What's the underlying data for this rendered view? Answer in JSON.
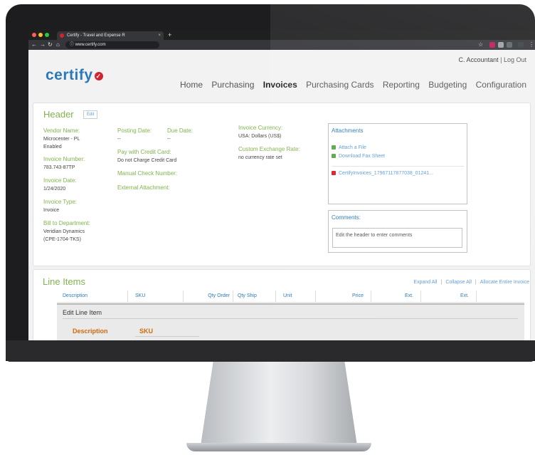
{
  "browser": {
    "tab_title": "Certify - Travel and Expense R",
    "tab_close": "×",
    "new_tab": "+",
    "url": "www.certify.com",
    "nav_icons": [
      "back-icon",
      "forward-icon",
      "reload-icon",
      "home-icon",
      "info-icon"
    ]
  },
  "app": {
    "logo_text": "certify",
    "user_name": "C. Accountant",
    "user_sep": "|",
    "logout": "Log Out",
    "nav": [
      "Home",
      "Purchasing",
      "Invoices",
      "Purchasing Cards",
      "Reporting",
      "Budgeting",
      "Configuration"
    ],
    "active_nav": "Invoices"
  },
  "header": {
    "title": "Header",
    "edit": "Edit",
    "vendor_label": "Vendor Name:",
    "vendor_value": [
      "Microcenter - PL",
      "Enabled"
    ],
    "invoice_number_label": "Invoice Number:",
    "invoice_number_value": "783.743-87TP",
    "invoice_date_label": "Invoice Date:",
    "invoice_date_value": "1/24/2020",
    "invoice_type_label": "Invoice Type:",
    "invoice_type_value": "Invoice",
    "bill_to_label": "Bill to Department:",
    "bill_to_value": [
      "Veridian Dynamics",
      "(CPE-1704-TKS)"
    ],
    "posting_date_label": "Posting Date:",
    "posting_date_value": "--",
    "due_date_label": "Due Date:",
    "due_date_value": "--",
    "pay_cc_label": "Pay with Credit Card:",
    "pay_cc_value": "Do not Charge Credit Card",
    "manual_check_label": "Manual Check Number:",
    "external_attachment_label": "External Attachment:",
    "currency_label": "Invoice Currency:",
    "currency_value": "USA: Dollars (US$)",
    "exchange_label": "Custom Exchange Rate:",
    "exchange_value": "no currency rate set"
  },
  "attachments": {
    "title": "Attachments",
    "attach": "Attach a File",
    "download": "Download Fax Sheet",
    "file": "CertifyInvoices_17967117877038_01241..."
  },
  "comments": {
    "title": "Comments:",
    "text": "Edit the header to enter comments"
  },
  "line_items": {
    "title": "Line Items",
    "expand_all": "Expand All",
    "collapse_all": "Collapse All",
    "allocate": "Allocate Entire Invoice",
    "sep": "|",
    "columns": [
      "Description",
      "SKU",
      "Qty Order",
      "Qty Ship",
      "Unit",
      "Price",
      "Ext.",
      "Ext."
    ],
    "edit_title": "Edit Line Item",
    "edit_description": "Description",
    "edit_sku": "SKU"
  },
  "colors": {
    "brand_blue": "#2a7ab8",
    "label_green": "#7fb34d",
    "brand_red": "#d3232f",
    "edit_orange": "#d06a0d"
  }
}
